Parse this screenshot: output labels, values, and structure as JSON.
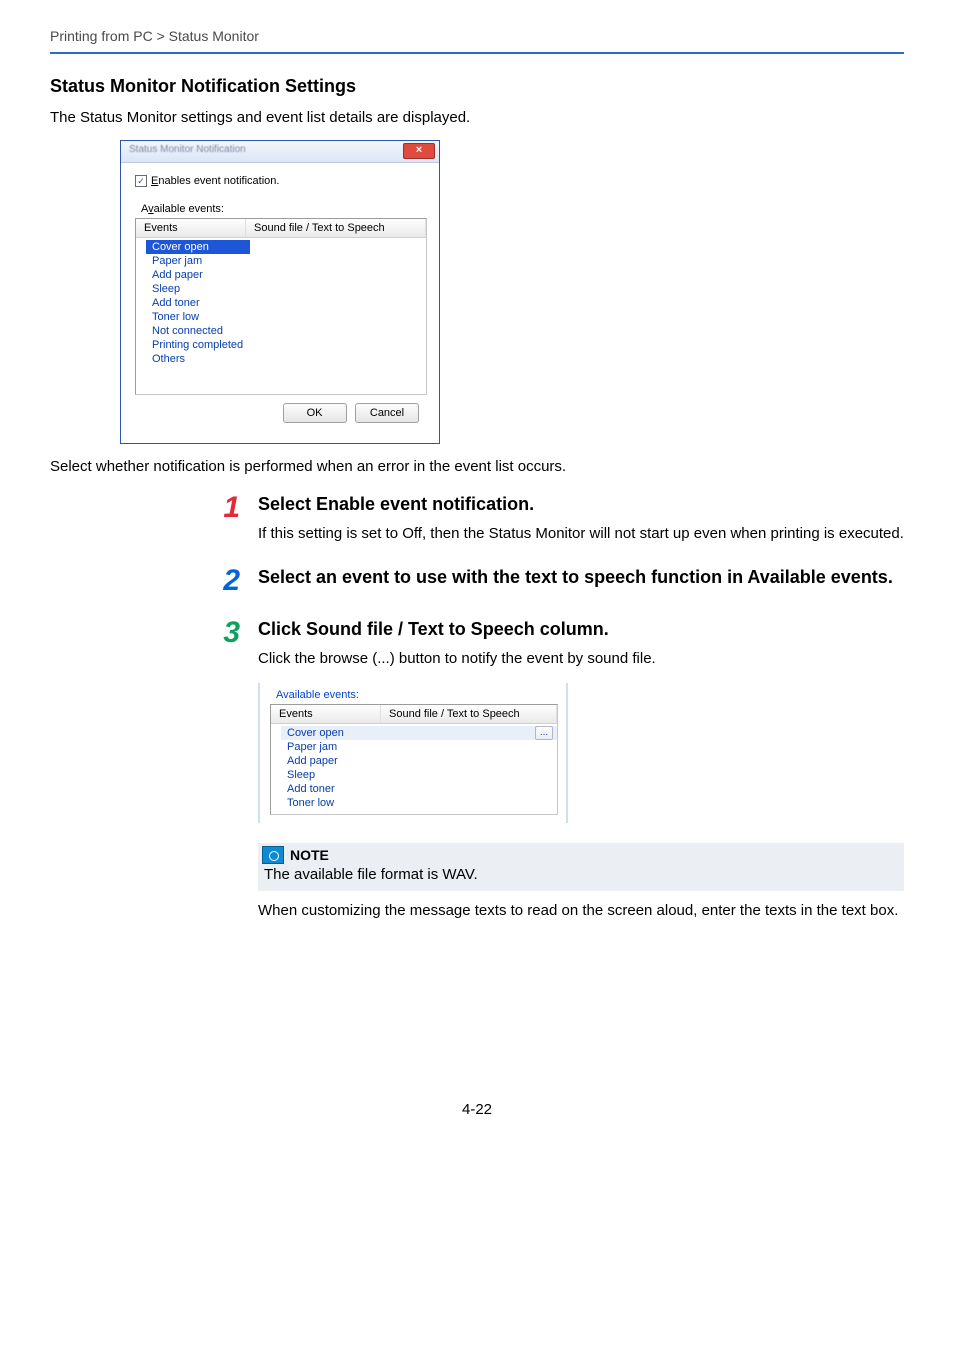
{
  "breadcrumb": "Printing from PC > Status Monitor",
  "h1": "Status Monitor Notification Settings",
  "intro": "The Status Monitor settings and event list details are displayed.",
  "dialog1": {
    "title_blur": "Status Monitor Notification",
    "close_glyph": "×",
    "checkbox_glyph": "✓",
    "checkbox_label": "Enables event notification.",
    "checkbox_underline_first": "E",
    "avail_label": "Available events:",
    "col_events": "Events",
    "col_sound": "Sound file / Text to Speech",
    "rows": {
      "r0": "Cover open",
      "r1": "Paper jam",
      "r2": "Add paper",
      "r3": "Sleep",
      "r4": "Add toner",
      "r5": "Toner low",
      "r6": "Not connected",
      "r7": "Printing completed",
      "r8": "Others"
    },
    "ok": "OK",
    "cancel": "Cancel"
  },
  "after_dialog": "Select whether notification is performed when an error in the event list occurs.",
  "steps": {
    "s1": {
      "num": "1",
      "title": "Select Enable event notification.",
      "text": "If this setting is set to Off, then the Status Monitor will not start up even when printing is executed."
    },
    "s2": {
      "num": "2",
      "title": "Select an event to use with the text to speech function in Available events."
    },
    "s3": {
      "num": "3",
      "title": "Click Sound file / Text to Speech column.",
      "text": "Click the browse (...) button to notify the event by sound file."
    }
  },
  "frag": {
    "avail_label": "Available events:",
    "col_events": "Events",
    "col_sound": "Sound file / Text to Speech",
    "rows": {
      "r0": "Cover open",
      "r1": "Paper jam",
      "r2": "Add paper",
      "r3": "Sleep",
      "r4": "Add toner",
      "r5": "Toner low"
    },
    "browse": "..."
  },
  "note": {
    "title": "NOTE",
    "text": "The available file format is WAV."
  },
  "after_note": "When customizing the message texts to read on the screen aloud, enter the texts in the text box.",
  "page_num": "4-22"
}
